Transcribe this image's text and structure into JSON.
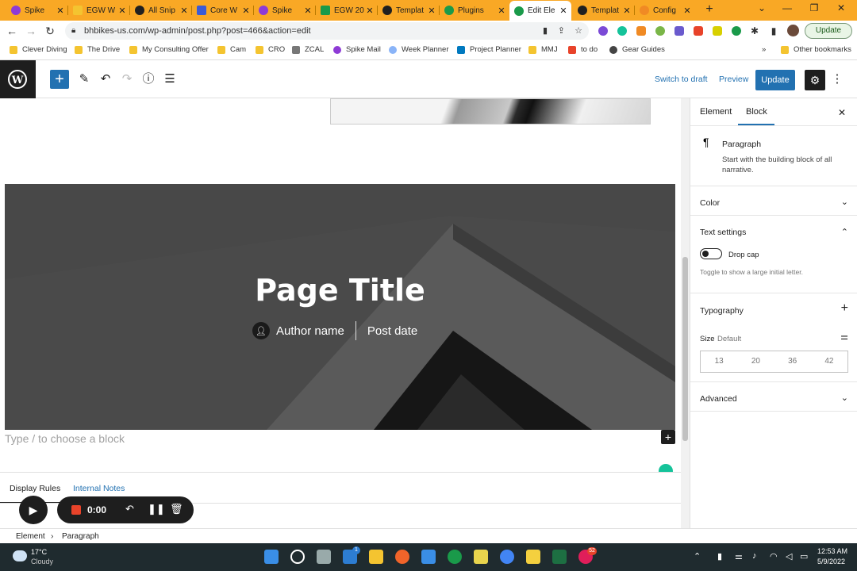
{
  "browser": {
    "tabs": [
      {
        "label": "Spike",
        "color": "#8e3bd6"
      },
      {
        "label": "EGW W",
        "color": "#f4c430"
      },
      {
        "label": "All Snip",
        "color": "#202020"
      },
      {
        "label": "Core W",
        "color": "#3b5bd6"
      },
      {
        "label": "Spike",
        "color": "#8e3bd6"
      },
      {
        "label": "EGW 20",
        "color": "#1a9a4a"
      },
      {
        "label": "Templat",
        "color": "#202020"
      },
      {
        "label": "Plugins",
        "color": "#1a9a4a"
      },
      {
        "label": "Edit Ele",
        "color": "#1a9a4a"
      },
      {
        "label": "Templat",
        "color": "#202020"
      },
      {
        "label": "Config",
        "color": "#f08a24"
      }
    ],
    "new_tab": "+",
    "url": "bhbikes-us.com/wp-admin/post.php?post=466&action=edit",
    "update_label": "Update",
    "bookmarks": [
      "Clever Diving",
      "The Drive",
      "My Consulting Offer",
      "Cam",
      "CRO",
      "ZCAL",
      "Spike Mail",
      "Week Planner",
      "Project Planner",
      "MMJ",
      "to do",
      "Gear Guides"
    ],
    "bookmarks_more": "»",
    "other_bookmarks": "Other bookmarks"
  },
  "toolbar": {
    "switch_to_draft": "Switch to draft",
    "preview": "Preview",
    "update": "Update"
  },
  "canvas": {
    "page_title": "Page Title",
    "author": "Author name",
    "post_date": "Post date",
    "placeholder": "Type / to choose a block"
  },
  "metabox": {
    "tabs": [
      "Display Rules",
      "Internal Notes"
    ]
  },
  "recorder": {
    "time": "0:00"
  },
  "sidebar": {
    "tabs": [
      "Element",
      "Block"
    ],
    "block_name": "Paragraph",
    "block_desc": "Start with the building block of all narrative.",
    "color": "Color",
    "text_settings": "Text settings",
    "drop_cap": "Drop cap",
    "drop_cap_help": "Toggle to show a large initial letter.",
    "typography": "Typography",
    "size_label": "Size",
    "size_value": "Default",
    "sizes": [
      "13",
      "20",
      "36",
      "42"
    ],
    "advanced": "Advanced"
  },
  "statusbar": {
    "crumbs": [
      "Element",
      "Paragraph"
    ]
  },
  "taskbar": {
    "temp": "17°C",
    "weather": "Cloudy",
    "time": "12:53 AM",
    "date": "5/9/2022",
    "badge_mail": "1",
    "badge_app": "52"
  }
}
